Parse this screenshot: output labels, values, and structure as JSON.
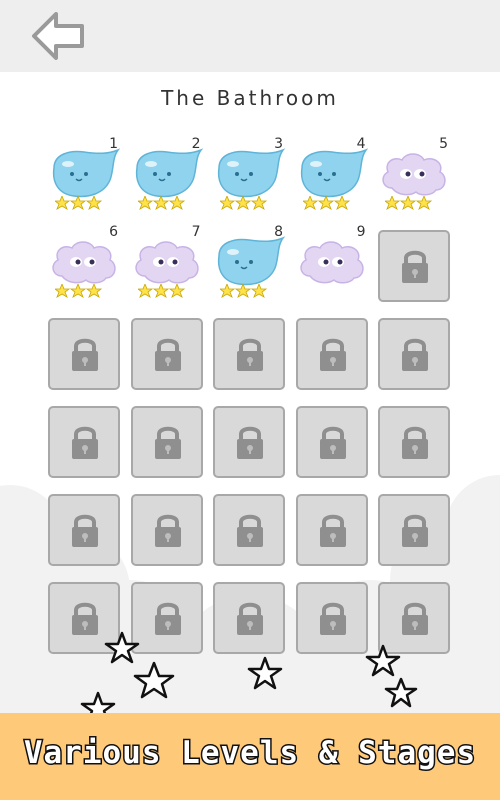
{
  "header": {
    "back_icon": "left-arrow-icon"
  },
  "stage": {
    "title": "The Bathroom"
  },
  "levels": [
    {
      "number": "1",
      "type": "drop",
      "stars": 3
    },
    {
      "number": "2",
      "type": "drop",
      "stars": 3
    },
    {
      "number": "3",
      "type": "drop",
      "stars": 3
    },
    {
      "number": "4",
      "type": "drop",
      "stars": 3
    },
    {
      "number": "5",
      "type": "cloud",
      "stars": 3
    },
    {
      "number": "6",
      "type": "cloud",
      "stars": 3
    },
    {
      "number": "7",
      "type": "cloud",
      "stars": 3
    },
    {
      "number": "8",
      "type": "drop",
      "stars": 3
    },
    {
      "number": "9",
      "type": "cloud",
      "stars": 0
    },
    {
      "number": "",
      "type": "locked",
      "stars": 0
    },
    {
      "number": "",
      "type": "locked",
      "stars": 0
    },
    {
      "number": "",
      "type": "locked",
      "stars": 0
    },
    {
      "number": "",
      "type": "locked",
      "stars": 0
    },
    {
      "number": "",
      "type": "locked",
      "stars": 0
    },
    {
      "number": "",
      "type": "locked",
      "stars": 0
    },
    {
      "number": "",
      "type": "locked",
      "stars": 0
    },
    {
      "number": "",
      "type": "locked",
      "stars": 0
    },
    {
      "number": "",
      "type": "locked",
      "stars": 0
    },
    {
      "number": "",
      "type": "locked",
      "stars": 0
    },
    {
      "number": "",
      "type": "locked",
      "stars": 0
    },
    {
      "number": "",
      "type": "locked",
      "stars": 0
    },
    {
      "number": "",
      "type": "locked",
      "stars": 0
    },
    {
      "number": "",
      "type": "locked",
      "stars": 0
    },
    {
      "number": "",
      "type": "locked",
      "stars": 0
    },
    {
      "number": "",
      "type": "locked",
      "stars": 0
    },
    {
      "number": "",
      "type": "locked",
      "stars": 0
    },
    {
      "number": "",
      "type": "locked",
      "stars": 0
    },
    {
      "number": "",
      "type": "locked",
      "stars": 0
    },
    {
      "number": "",
      "type": "locked",
      "stars": 0
    },
    {
      "number": "",
      "type": "locked",
      "stars": 0
    }
  ],
  "banner": {
    "text": "Various Levels & Stages"
  },
  "colors": {
    "header_bg": "#eeeeee",
    "drop": "#8fd3ee",
    "cloud": "#e3d6f2",
    "star": "#ffe24a",
    "locked_bg": "#d9d9d9",
    "banner_bg": "#ffc97a"
  }
}
